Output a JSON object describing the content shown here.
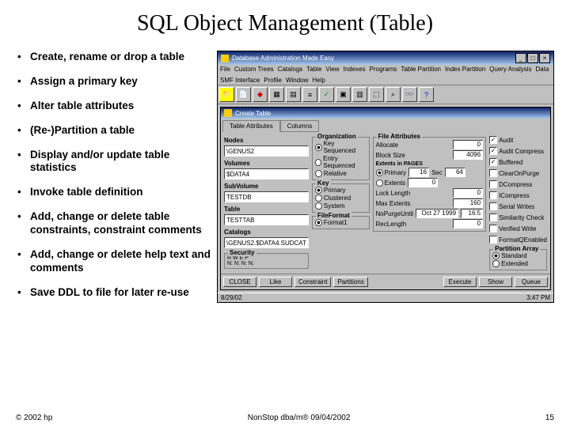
{
  "title": "SQL Object Management (Table)",
  "bullets": [
    "Create, rename or drop a table",
    "Assign a primary key",
    "Alter table attributes",
    "(Re-)Partition a table",
    "Display and/or update table statistics",
    "Invoke table definition",
    "Add, change or delete table constraints, constraint comments",
    "Add, change or delete help text and comments",
    "Save DDL to file for later re-use"
  ],
  "app": {
    "title": "Database Administration Made Easy",
    "menus": [
      "File",
      "Custom Trees",
      "Catalogs",
      "Table",
      "View",
      "Indexes",
      "Programs",
      "Table Partition",
      "Index Partition",
      "Query Analysis",
      "Data",
      "SMF Interface",
      "Profile",
      "Window",
      "Help"
    ],
    "dialogTitle": "Create Table",
    "tabs": [
      "Table Attributes",
      "Columns"
    ],
    "left": {
      "nodesLabel": "Nodes",
      "nodes": "\\GENUS2",
      "volumesLabel": "Volumes",
      "volumes": "$DATA4",
      "subvolLabel": "SubVolume",
      "subvol": "TESTDB",
      "tableLabel": "Table",
      "table": "TESTTAB",
      "catalogsLabel": "Catalogs",
      "catalogs": "\\GENUS2.$DATA4.SUDCAT",
      "securityLabel": "Security",
      "sec": "R   W   E   P",
      "sec2": "N:  N:   N:   N:"
    },
    "org": {
      "title": "Organization",
      "o1": "Key Sequenced",
      "o2": "Entry Sequenced",
      "o3": "Relative"
    },
    "key": {
      "title": "Key",
      "o1": "Primary",
      "o2": "Clustered",
      "o3": "System"
    },
    "fileformat": {
      "title": "FileFormat",
      "o1": "Format1"
    },
    "fileattrs": {
      "title": "File Attributes",
      "allocate": "Allocate",
      "allocateVal": "0",
      "blocksize": "Block Size",
      "blocksizeVal": "4096",
      "extentsTitle": "Extents in PAGES",
      "primary": "Primary",
      "primaryVal": "16",
      "sec": "Sec",
      "secVal": "64",
      "extents": "Extents",
      "extentsVal": "0",
      "locklen": "Lock Length",
      "locklenVal": "0",
      "maxext": "Max Extents",
      "maxextVal": "160",
      "nopurge": "NoPurgeUntil",
      "nopurgeVal": "Oct 27 1999",
      "nopurgeTime": "16:5",
      "reclen": "RecLength",
      "reclenVal": "0"
    },
    "checks": {
      "audit": "Audit",
      "auditcomp": "Audit Compress",
      "buffered": "Buffered",
      "clearpurge": "ClearOnPurge",
      "dcomp": "DCompress",
      "icomp": "ICompress",
      "serial": "Serial Writes",
      "sim": "Similarity Check",
      "verify": "Verified Write",
      "fqe": "FormatQEnabled"
    },
    "partarray": {
      "title": "Partition Array",
      "o1": "Standard",
      "o2": "Extended"
    },
    "buttons": {
      "close": "CLOSE",
      "like": "Like",
      "constraint": "Constraint",
      "partitions": "Partitions",
      "execute": "Execute",
      "show": "Show",
      "queue": "Queue"
    },
    "status": {
      "date": "8/29/02",
      "time": "3:47 PM"
    }
  },
  "footer": {
    "left": "© 2002 hp",
    "center": "NonStop dba/m® 09/04/2002",
    "right": "15"
  }
}
